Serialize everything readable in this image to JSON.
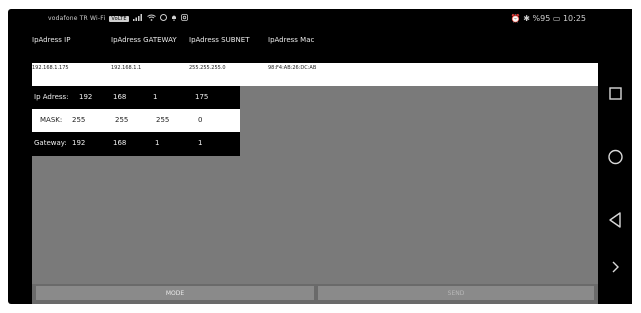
{
  "status_bar": {
    "carrier": "vodafone TR Wi-Fi",
    "network_badge": "VoLTE",
    "icons_left": [
      "signal-icon",
      "wifi-icon",
      "sync-icon",
      "notification-icon",
      "instagram-icon"
    ],
    "right": "⏰ ✱ %95 ▭ 10:25"
  },
  "headers": {
    "ip": "IpAdress IP",
    "gateway": "IpAdress GATEWAY",
    "subnet": "IpAdress SUBNET",
    "mac": "IpAdress Mac"
  },
  "values": {
    "ip": "192.168.1.175",
    "gateway": "192.168.1.1",
    "subnet": "255.255.255.0",
    "mac": "98:F4:AB:26:DC:AB"
  },
  "config": {
    "ip": {
      "label": "Ip Adress:",
      "o1": "192",
      "o2": "168",
      "o3": "1",
      "o4": "175"
    },
    "mask": {
      "label": "MASK:",
      "o1": "255",
      "o2": "255",
      "o3": "255",
      "o4": "0"
    },
    "gateway": {
      "label": "Gateway:",
      "o1": "192",
      "o2": "168",
      "o3": "1",
      "o4": "1"
    }
  },
  "buttons": {
    "mode": "MODE",
    "second": "SEND"
  },
  "nav_icons": [
    "square-icon",
    "circle-icon",
    "back-triangle-icon",
    "chevron-right-icon"
  ]
}
